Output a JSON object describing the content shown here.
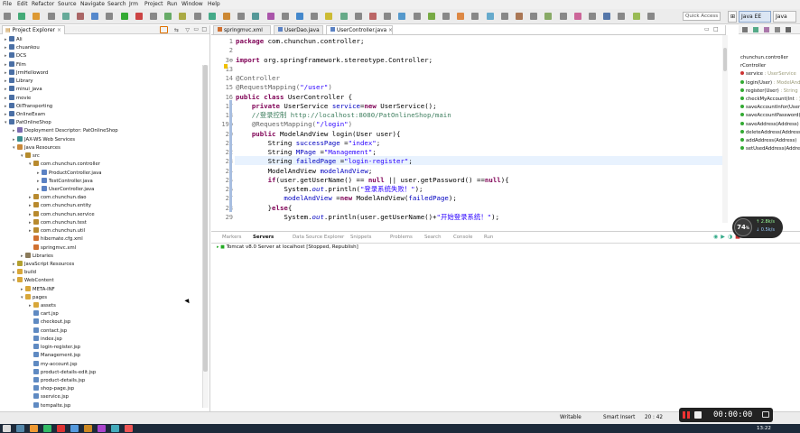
{
  "menubar": {
    "items": [
      "File",
      "Edit",
      "Refactor",
      "Source",
      "Navigate",
      "Search",
      "Jrm",
      "Project",
      "Run",
      "Window",
      "Help"
    ]
  },
  "toolbar": {
    "quick_access_placeholder": "Quick Access",
    "perspectives": [
      {
        "label": "Java EE",
        "active": true
      },
      {
        "label": "Java",
        "active": false
      }
    ]
  },
  "project_explorer": {
    "title": "Project Explorer",
    "items": [
      {
        "label": "Ali",
        "depth": 0,
        "twisty": "▸",
        "icon": "project-icon"
      },
      {
        "label": "chuankou",
        "depth": 0,
        "twisty": "▸",
        "icon": "project-icon"
      },
      {
        "label": "DCS",
        "depth": 0,
        "twisty": "▸",
        "icon": "project-icon"
      },
      {
        "label": "Film",
        "depth": 0,
        "twisty": "▸",
        "icon": "project-icon"
      },
      {
        "label": "JrmHelloword",
        "depth": 0,
        "twisty": "▸",
        "icon": "project-icon"
      },
      {
        "label": "Library",
        "depth": 0,
        "twisty": "▸",
        "icon": "project-icon"
      },
      {
        "label": "minui_java",
        "depth": 0,
        "twisty": "▸",
        "icon": "project-icon"
      },
      {
        "label": "movie",
        "depth": 0,
        "twisty": "▸",
        "icon": "project-icon"
      },
      {
        "label": "OilTransporting",
        "depth": 0,
        "twisty": "▸",
        "icon": "project-icon"
      },
      {
        "label": "OnlineExam",
        "depth": 0,
        "twisty": "▸",
        "icon": "project-icon"
      },
      {
        "label": "PatOnlineShop",
        "depth": 0,
        "twisty": "▾",
        "icon": "project-icon"
      },
      {
        "label": "Deployment Descriptor: PatOnlineShop",
        "depth": 1,
        "twisty": "▸",
        "icon": "descriptor-icon"
      },
      {
        "label": "JAX-WS Web Services",
        "depth": 1,
        "twisty": "▸",
        "icon": "webservice-icon"
      },
      {
        "label": "Java Resources",
        "depth": 1,
        "twisty": "▾",
        "icon": "java-resources-icon"
      },
      {
        "label": "src",
        "depth": 2,
        "twisty": "▾",
        "icon": "source-folder-icon"
      },
      {
        "label": "com.chunchun.controller",
        "depth": 3,
        "twisty": "▾",
        "icon": "package-icon"
      },
      {
        "label": "ProductController.java",
        "depth": 4,
        "twisty": "▸",
        "icon": "java-file-icon"
      },
      {
        "label": "TestController.java",
        "depth": 4,
        "twisty": "▸",
        "icon": "java-file-icon"
      },
      {
        "label": "UserController.java",
        "depth": 4,
        "twisty": "▸",
        "icon": "java-file-icon"
      },
      {
        "label": "com.chunchun.dao",
        "depth": 3,
        "twisty": "▸",
        "icon": "package-icon"
      },
      {
        "label": "com.chunchun.entity",
        "depth": 3,
        "twisty": "▸",
        "icon": "package-icon"
      },
      {
        "label": "com.chunchun.service",
        "depth": 3,
        "twisty": "▸",
        "icon": "package-icon"
      },
      {
        "label": "com.chunchun.test",
        "depth": 3,
        "twisty": "▸",
        "icon": "package-icon"
      },
      {
        "label": "com.chunchun.util",
        "depth": 3,
        "twisty": "▸",
        "icon": "package-icon"
      },
      {
        "label": "hibernate.cfg.xml",
        "depth": 3,
        "twisty": "",
        "icon": "xml-file-icon"
      },
      {
        "label": "springmvc.xml",
        "depth": 3,
        "twisty": "",
        "icon": "xml-file-icon"
      },
      {
        "label": "Libraries",
        "depth": 2,
        "twisty": "▸",
        "icon": "library-icon"
      },
      {
        "label": "JavaScript Resources",
        "depth": 1,
        "twisty": "▸",
        "icon": "js-resources-icon"
      },
      {
        "label": "build",
        "depth": 1,
        "twisty": "▸",
        "icon": "folder-icon"
      },
      {
        "label": "WebContent",
        "depth": 1,
        "twisty": "▾",
        "icon": "folder-icon"
      },
      {
        "label": "META-INF",
        "depth": 2,
        "twisty": "▸",
        "icon": "folder-icon"
      },
      {
        "label": "pages",
        "depth": 2,
        "twisty": "▾",
        "icon": "folder-icon"
      },
      {
        "label": "assets",
        "depth": 3,
        "twisty": "▸",
        "icon": "folder-icon"
      },
      {
        "label": "cart.jsp",
        "depth": 3,
        "twisty": "",
        "icon": "jsp-file-icon"
      },
      {
        "label": "checkout.jsp",
        "depth": 3,
        "twisty": "",
        "icon": "jsp-file-icon"
      },
      {
        "label": "contact.jsp",
        "depth": 3,
        "twisty": "",
        "icon": "jsp-file-icon"
      },
      {
        "label": "index.jsp",
        "depth": 3,
        "twisty": "",
        "icon": "jsp-file-icon"
      },
      {
        "label": "login-register.jsp",
        "depth": 3,
        "twisty": "",
        "icon": "jsp-file-icon"
      },
      {
        "label": "Management.jsp",
        "depth": 3,
        "twisty": "",
        "icon": "jsp-file-icon"
      },
      {
        "label": "my-account.jsp",
        "depth": 3,
        "twisty": "",
        "icon": "jsp-file-icon"
      },
      {
        "label": "product-details-edit.jsp",
        "depth": 3,
        "twisty": "",
        "icon": "jsp-file-icon"
      },
      {
        "label": "product-details.jsp",
        "depth": 3,
        "twisty": "",
        "icon": "jsp-file-icon"
      },
      {
        "label": "shop-page.jsp",
        "depth": 3,
        "twisty": "",
        "icon": "jsp-file-icon"
      },
      {
        "label": "sservice.jsp",
        "depth": 3,
        "twisty": "",
        "icon": "jsp-file-icon"
      },
      {
        "label": "tempalte.jsp",
        "depth": 3,
        "twisty": "",
        "icon": "jsp-file-icon"
      }
    ]
  },
  "editor": {
    "tabs": [
      {
        "label": "springmvc.xml",
        "active": false
      },
      {
        "label": "UserDao.java",
        "active": false
      },
      {
        "label": "UserController.java",
        "active": true
      }
    ],
    "lines": [
      {
        "num": "1",
        "tokens": [
          {
            "t": "package",
            "c": "kw"
          },
          {
            "t": " com.chunchun.controller;",
            "c": ""
          }
        ]
      },
      {
        "num": "2",
        "tokens": []
      },
      {
        "num": "3⊕",
        "tokens": [
          {
            "t": "import",
            "c": "kw"
          },
          {
            "t": " org.springframework.stereotype.Controller;",
            "c": ""
          }
        ]
      },
      {
        "num": "13",
        "tokens": []
      },
      {
        "num": "14",
        "tokens": [
          {
            "t": "@Controller",
            "c": "an"
          }
        ]
      },
      {
        "num": "15",
        "tokens": [
          {
            "t": "@RequestMapping(",
            "c": "an"
          },
          {
            "t": "\"/user\"",
            "c": "st"
          },
          {
            "t": ")",
            "c": "an"
          }
        ]
      },
      {
        "num": "16",
        "tokens": [
          {
            "t": "public",
            "c": "kw"
          },
          {
            "t": " ",
            "c": ""
          },
          {
            "t": "class",
            "c": "kw"
          },
          {
            "t": " UserController {",
            "c": ""
          }
        ]
      },
      {
        "num": "17",
        "tokens": [
          {
            "t": "    ",
            "c": ""
          },
          {
            "t": "private",
            "c": "kw"
          },
          {
            "t": " UserService ",
            "c": ""
          },
          {
            "t": "service",
            "c": "fd"
          },
          {
            "t": "=",
            "c": ""
          },
          {
            "t": "new",
            "c": "kw"
          },
          {
            "t": " UserService();",
            "c": ""
          }
        ]
      },
      {
        "num": "18",
        "tokens": [
          {
            "t": "    //登录控制 http://localhost:8080/PatOnlineShop/main",
            "c": "cm"
          }
        ]
      },
      {
        "num": "19⊖",
        "tokens": [
          {
            "t": "    @RequestMapping(",
            "c": "an"
          },
          {
            "t": "\"/login\"",
            "c": "st"
          },
          {
            "t": ")",
            "c": "an"
          }
        ]
      },
      {
        "num": "20",
        "tokens": [
          {
            "t": "    ",
            "c": ""
          },
          {
            "t": "public",
            "c": "kw"
          },
          {
            "t": " ModelAndView login(User user){",
            "c": ""
          }
        ]
      },
      {
        "num": "21",
        "tokens": [
          {
            "t": "        String ",
            "c": ""
          },
          {
            "t": "successPage",
            "c": "fd"
          },
          {
            "t": " =",
            "c": ""
          },
          {
            "t": "\"index\"",
            "c": "st"
          },
          {
            "t": ";",
            "c": ""
          }
        ]
      },
      {
        "num": "22",
        "tokens": [
          {
            "t": "        String ",
            "c": ""
          },
          {
            "t": "MPage",
            "c": "fd"
          },
          {
            "t": " =",
            "c": ""
          },
          {
            "t": "\"Management\"",
            "c": "st"
          },
          {
            "t": ";",
            "c": ""
          }
        ]
      },
      {
        "num": "23",
        "tokens": [
          {
            "t": "        String ",
            "c": ""
          },
          {
            "t": "failedPage",
            "c": "fd"
          },
          {
            "t": " =",
            "c": ""
          },
          {
            "t": "\"login-register\"",
            "c": "st"
          },
          {
            "t": ";",
            "c": ""
          }
        ]
      },
      {
        "num": "24",
        "tokens": [
          {
            "t": "        ModelAndView ",
            "c": ""
          },
          {
            "t": "modelAndView",
            "c": "fd"
          },
          {
            "t": ";",
            "c": ""
          }
        ]
      },
      {
        "num": "25",
        "tokens": [
          {
            "t": "        ",
            "c": ""
          },
          {
            "t": "if",
            "c": "kw"
          },
          {
            "t": "(user.getUserName() == ",
            "c": ""
          },
          {
            "t": "null",
            "c": "kw"
          },
          {
            "t": " || user.getPassword() ==",
            "c": ""
          },
          {
            "t": "null",
            "c": "kw"
          },
          {
            "t": "){",
            "c": ""
          }
        ]
      },
      {
        "num": "26",
        "tokens": [
          {
            "t": "            System.",
            "c": ""
          },
          {
            "t": "out",
            "c": "fd it"
          },
          {
            "t": ".println(",
            "c": ""
          },
          {
            "t": "\"登录系统失败！\"",
            "c": "st"
          },
          {
            "t": ");",
            "c": ""
          }
        ]
      },
      {
        "num": "27",
        "tokens": [
          {
            "t": "            ",
            "c": ""
          },
          {
            "t": "modelAndView",
            "c": "fd"
          },
          {
            "t": " =",
            "c": ""
          },
          {
            "t": "new",
            "c": "kw"
          },
          {
            "t": " ModelAndView(",
            "c": ""
          },
          {
            "t": "failedPage",
            "c": "fd"
          },
          {
            "t": ");",
            "c": ""
          }
        ]
      },
      {
        "num": "28",
        "tokens": [
          {
            "t": "        }",
            "c": ""
          },
          {
            "t": "else",
            "c": "kw"
          },
          {
            "t": "{",
            "c": ""
          }
        ]
      },
      {
        "num": "29",
        "tokens": [
          {
            "t": "            System.",
            "c": ""
          },
          {
            "t": "out",
            "c": "fd it"
          },
          {
            "t": ".println(user.getUserName()+",
            "c": ""
          },
          {
            "t": "\"开始登录系统！\"",
            "c": "st"
          },
          {
            "t": ");",
            "c": ""
          }
        ]
      }
    ]
  },
  "outline": {
    "items": [
      {
        "label": "chunchun.controller",
        "hint": ""
      },
      {
        "label": "rController",
        "hint": ""
      },
      {
        "label": "service",
        "hint": " : UserService"
      },
      {
        "label": "login(User)",
        "hint": " : ModelAnd"
      },
      {
        "label": "register(User)",
        "hint": " : String"
      },
      {
        "label": "checkMyAccount(Int",
        "hint": " : )"
      },
      {
        "label": "saveAccountInfor(User",
        "hint": ""
      },
      {
        "label": "saveAccountPassword(",
        "hint": ""
      },
      {
        "label": "saveAddress(Address)",
        "hint": ""
      },
      {
        "label": "deleteAddress(Address)",
        "hint": ""
      },
      {
        "label": "addAddress(Address)",
        "hint": ""
      },
      {
        "label": "setUsedAddress(Address",
        "hint": ""
      }
    ]
  },
  "bottom_panel": {
    "tabs": [
      {
        "label": "Markers",
        "active": false
      },
      {
        "label": "Servers",
        "active": true
      },
      {
        "label": "Data Source Explorer",
        "active": false
      },
      {
        "label": "Snippets",
        "active": false
      },
      {
        "label": "Problems",
        "active": false
      },
      {
        "label": "Search",
        "active": false
      },
      {
        "label": "Console",
        "active": false
      },
      {
        "label": "Run",
        "active": false
      }
    ],
    "server_row": "Tomcat v8.0 Server at localhost  [Stopped, Republish]"
  },
  "status": {
    "writable": "Writable",
    "insert_mode": "Smart Insert",
    "position": "20 : 42"
  },
  "gauge": {
    "percent": "74",
    "unit": "%",
    "up": "2.8k/s",
    "down": "0.5k/s"
  },
  "recorder": {
    "time": "00:00:00"
  },
  "clock": {
    "time": "13:22"
  },
  "colors": {
    "keyword": "#7f0055",
    "string": "#2a00ff",
    "comment": "#3f7f5f",
    "field": "#0000c0",
    "annotation": "#646464",
    "current_line": "#e8f2fe"
  }
}
